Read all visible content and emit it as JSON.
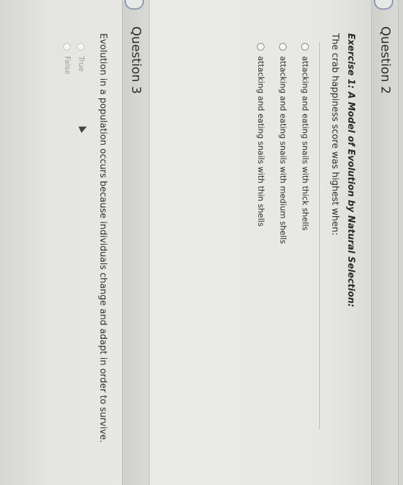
{
  "questions": [
    {
      "title": "Question 2",
      "exercise": "Exercise 1: A Model of Evolution by Natural Selection:",
      "text": "The crab happiness score was highest when:",
      "options": [
        "attacking and eating snails with thick shells",
        "attacking and eating snails with medium shells",
        "attacking and eating snails with thin shells"
      ]
    },
    {
      "title": "Question 3",
      "text": "Evolution in a population occurs because individuals change and adapt in order to survive.",
      "options": [
        "True",
        "False"
      ]
    }
  ],
  "icons": {
    "question_marker": "flag-tab-icon",
    "radio": "radio-button-icon",
    "pointer": "mouse-pointer-icon"
  },
  "colors": {
    "header_bg": "#d3d3d0",
    "marker_border": "#8a9bb0",
    "text": "#2b2b2b",
    "faint_text": "#9a9a9a"
  }
}
